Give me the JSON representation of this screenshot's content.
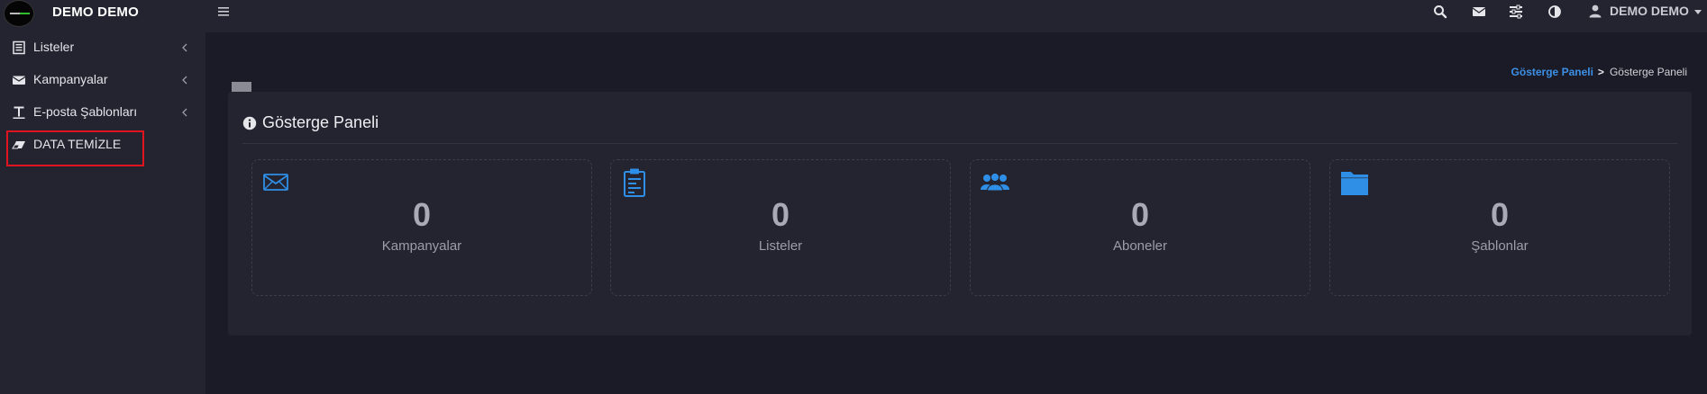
{
  "header": {
    "app_title": "DEMO DEMO",
    "user_name": "DEMO DEMO",
    "icons": [
      "menu-icon",
      "search-icon",
      "envelope-icon",
      "settings-sliders-icon",
      "contrast-icon",
      "user-icon"
    ]
  },
  "sidebar": {
    "items": [
      {
        "label": "Listeler",
        "icon": "list-icon",
        "has_submenu": true
      },
      {
        "label": "Kampanyalar",
        "icon": "envelope-icon",
        "has_submenu": true
      },
      {
        "label": "E-posta Şablonları",
        "icon": "text-icon",
        "has_submenu": true
      },
      {
        "label": "DATA TEMİZLE",
        "icon": "eraser-icon",
        "has_submenu": false,
        "highlighted": true
      }
    ]
  },
  "breadcrumb": {
    "link": "Gösterge Paneli",
    "separator": ">",
    "current": "Gösterge Paneli"
  },
  "panel": {
    "title": "Gösterge Paneli",
    "cards": [
      {
        "icon": "mail-icon",
        "value": "0",
        "label": "Kampanyalar"
      },
      {
        "icon": "clipboard-icon",
        "value": "0",
        "label": "Listeler"
      },
      {
        "icon": "users-icon",
        "value": "0",
        "label": "Aboneler"
      },
      {
        "icon": "folder-icon",
        "value": "0",
        "label": "Şablonlar"
      }
    ]
  },
  "colors": {
    "background": "#1a1b26",
    "surface": "#23242f",
    "accent": "#3d8fe6",
    "icon_blue": "#2f8ee5",
    "highlight_border": "#e0141e"
  }
}
